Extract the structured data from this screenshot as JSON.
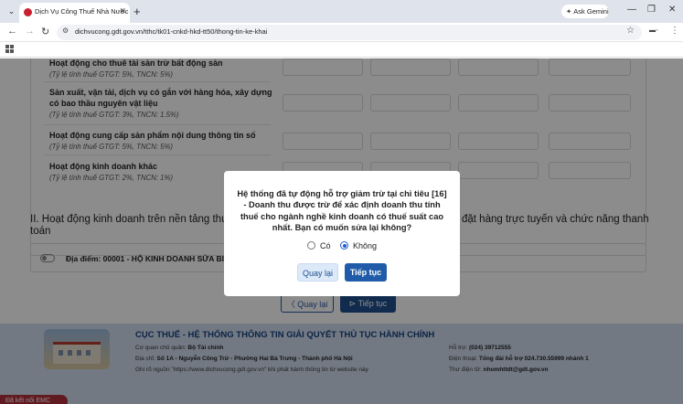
{
  "browser": {
    "tab_title": "Dịch Vụ Công Thuế Nhà Nước",
    "new_tab": "+",
    "gemini_label": "Ask Gemini",
    "url": "dichvucong.gdt.gov.vn/tthc/tk01-cnkd-hkd-tt50/thong-tin-ke-khai"
  },
  "form": {
    "rows": [
      {
        "title": "Hoạt động cho thuê tài sản trừ bất động sản",
        "note": "(Tỷ lệ tính thuế GTGT: 5%, TNCN: 5%)"
      },
      {
        "title": "Sản xuất, vận tải, dịch vụ có gắn với hàng hóa, xây dựng có bao thầu nguyên vật liệu",
        "note": "(Tỷ lệ tính thuế GTGT: 3%, TNCN: 1.5%)"
      },
      {
        "title": "Hoạt động cung cấp sản phẩm nội dung thông tin số",
        "note": "(Tỷ lệ tính thuế GTGT: 5%, TNCN: 5%)"
      },
      {
        "title": "Hoạt động kinh doanh khác",
        "note": "(Tỷ lệ tính thuế GTGT: 2%, TNCN: 1%)"
      }
    ],
    "section2_left": "II. Hoạt động kinh doanh trên nền tảng thươ",
    "section2_left_line2": "toán",
    "section2_right": "đặt hàng trực tuyến và chức năng thanh",
    "location": "Địa điểm: 00001 - HỘ KINH DOANH SỬA BI",
    "back_label": "〈 Quay lại",
    "next_label": "⊳ Tiếp tục"
  },
  "footer": {
    "title": "CỤC THUẾ - HỆ THỐNG THÔNG TIN GIẢI QUYẾT THỦ TỤC HÀNH CHÍNH",
    "owner_label": "Cơ quan chủ quản:",
    "owner": "Bộ Tài chính",
    "address_label": "Địa chỉ:",
    "address": "Số 1A - Nguyễn Công Trứ - Phường Hai Bà Trưng - Thành phố Hà Nội",
    "source": "Ghi rõ nguồn \"https://www.dichvucong.gdt.gov.vn\" khi phát hành thông tin từ website này",
    "support_label": "Hỗ trợ:",
    "support": "(024) 39712555",
    "hotline_label": "Điện thoại:",
    "hotline": "Tổng đài hỗ trợ 024.730.55999 nhánh 1",
    "email_label": "Thư điện tử:",
    "email": "nhomhttdt@gdt.gov.vn"
  },
  "emc_badge": "Đã kết nối EMC",
  "modal": {
    "message": "Hệ thống đã tự động hỗ trợ giảm trừ tại chỉ tiêu [16] - Doanh thu được trừ để xác định doanh thu tính thuế cho ngành nghề kinh doanh có thuế suất cao nhất. Bạn có muốn sửa lại không?",
    "option_yes": "Có",
    "option_no": "Không",
    "selected": "Không",
    "back": "Quay lại",
    "continue": "Tiếp tục"
  }
}
